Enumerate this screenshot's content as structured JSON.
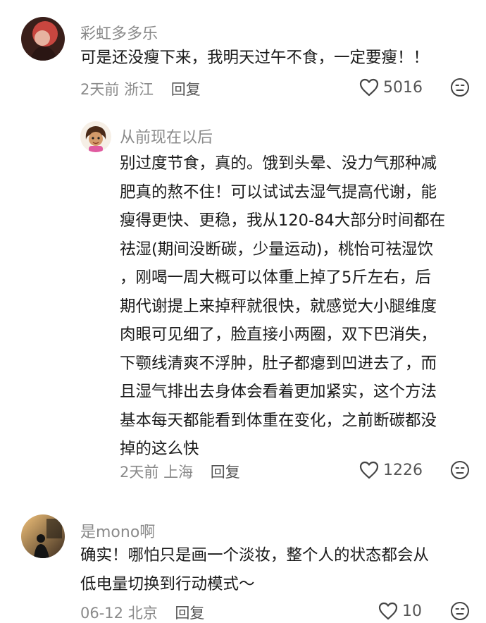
{
  "comments": [
    {
      "username": "彩虹多多乐",
      "text_lines": [
        "可是还没瘦下来，我明天过午不食，一定要瘦！！"
      ],
      "time": "2天前",
      "location": "浙江",
      "reply_label": "回复",
      "likes": "5016"
    },
    {
      "username": "从前现在以后",
      "text_lines": [
        "别过度节食，真的。饿到头晕、没力气那种减",
        "肥真的熬不住！可以试试去湿气提高代谢，能",
        "瘦得更快、更稳，我从120-84大部分时间都在",
        "祛湿(期间没断碳，少量运动)，桃怡可祛湿饮",
        "，刚喝一周大概可以体重上掉了5斤左右，后",
        "期代谢提上来掉秤就很快，就感觉大小腿维度",
        "肉眼可见细了，脸直接小两圈，双下巴消失，",
        "下颚线清爽不浮肿，肚子都瘪到凹进去了，而",
        "且湿气排出去身体会看着更加紧实，这个方法",
        "基本每天都能看到体重在变化，之前断碳都没",
        "掉的这么快"
      ],
      "time": "2天前",
      "location": "上海",
      "reply_label": "回复",
      "likes": "1226"
    },
    {
      "username": "是mono啊",
      "text_lines": [
        "确实！哪怕只是画一个淡妆，整个人的状态都会从",
        "低电量切换到行动模式～"
      ],
      "time": "06-12",
      "location": "北京",
      "reply_label": "回复",
      "likes": "10"
    }
  ],
  "icons": {
    "like": "heart-outline-icon",
    "dislike": "unhappy-face-icon"
  },
  "colors": {
    "text": "#1a1a1a",
    "muted": "#8a8a8a",
    "background": "#ffffff"
  }
}
